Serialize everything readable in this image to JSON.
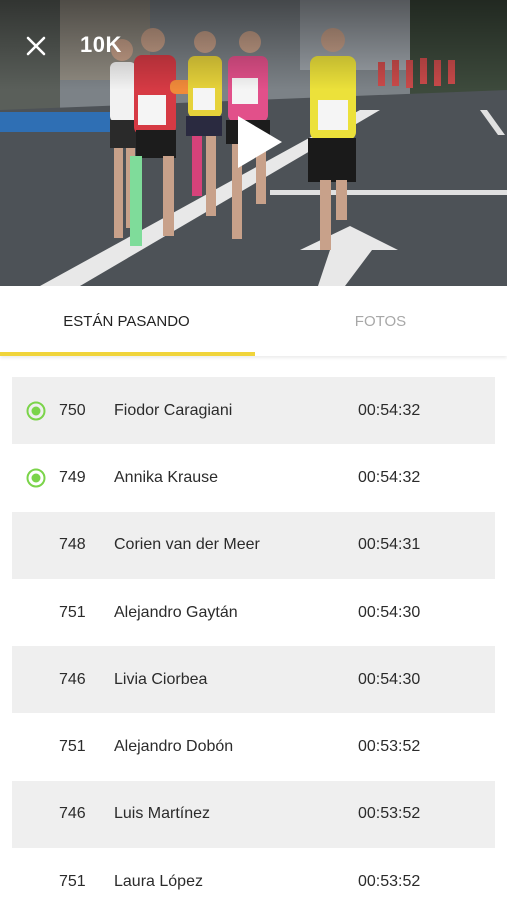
{
  "header": {
    "title": "10K",
    "close_icon": "close-icon",
    "play_icon": "play-icon"
  },
  "tabs": [
    {
      "label": "ESTÁN PASANDO",
      "active": true
    },
    {
      "label": "FOTOS",
      "active": false
    }
  ],
  "colors": {
    "accent": "#f0d43a",
    "live_indicator": "#7bd44a",
    "row_shade": "#efefef"
  },
  "runners": [
    {
      "bib": "750",
      "name": "Fiodor Caragiani",
      "time": "00:54:32",
      "live": true
    },
    {
      "bib": "749",
      "name": "Annika Krause",
      "time": "00:54:32",
      "live": true
    },
    {
      "bib": "748",
      "name": "Corien van der Meer",
      "time": "00:54:31",
      "live": false
    },
    {
      "bib": "751",
      "name": "Alejandro Gaytán",
      "time": "00:54:30",
      "live": false
    },
    {
      "bib": "746",
      "name": "Livia Ciorbea",
      "time": "00:54:30",
      "live": false
    },
    {
      "bib": "751",
      "name": "Alejandro Dobón",
      "time": "00:53:52",
      "live": false
    },
    {
      "bib": "746",
      "name": "Luis Martínez",
      "time": "00:53:52",
      "live": false
    },
    {
      "bib": "751",
      "name": "Laura López",
      "time": "00:53:52",
      "live": false
    }
  ]
}
